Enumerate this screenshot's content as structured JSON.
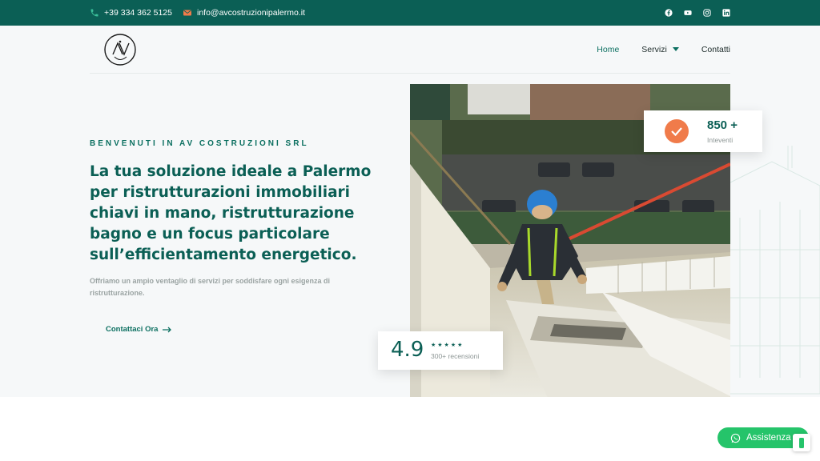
{
  "topbar": {
    "phone": "+39 334 362 5125",
    "email": "info@avcostruzionipalermo.it",
    "socials": [
      "facebook-icon",
      "youtube-icon",
      "instagram-icon",
      "linkedin-icon"
    ]
  },
  "nav": {
    "items": [
      {
        "label": "Home",
        "active": true
      },
      {
        "label": "Servizi",
        "has_dropdown": true
      },
      {
        "label": "Contatti"
      }
    ]
  },
  "hero": {
    "eyebrow": "BENVENUTI IN AV COSTRUZIONI SRL",
    "headline": "La tua soluzione ideale a Palermo per ristrutturazioni immobiliari chiavi in mano, ristrutturazione bagno e un focus particolare sull’efficientamento energetico.",
    "subtext": "Offriamo un ampio ventaglio di servizi per soddisfare ogni esigenza di ristrutturazione.",
    "cta_label": "Contattaci Ora"
  },
  "stats": {
    "count": "850 +",
    "count_label": "Inteventi",
    "rating": "4.9",
    "stars": "★★★★★",
    "reviews": "300+ recensioni"
  },
  "widget": {
    "chat_label": "Assistenza"
  },
  "colors": {
    "brand": "#0b5f55",
    "accent": "#f07b4a",
    "whatsapp": "#25c46a"
  }
}
